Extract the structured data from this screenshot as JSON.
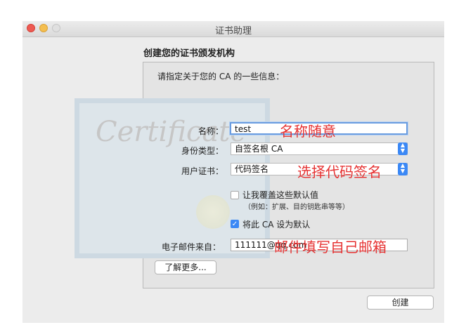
{
  "window": {
    "title": "证书助理"
  },
  "heading": "创建您的证书颁发机构",
  "intro": "请指定关于您的 CA 的一些信息：",
  "background_text": "Certificate",
  "form": {
    "name_label": "名称：",
    "name_value": "test",
    "identity_label": "身份类型：",
    "identity_value": "自签名根 CA",
    "user_cert_label": "用户证书：",
    "user_cert_value": "代码签名",
    "override_label": "让我覆盖这些默认值",
    "override_hint": "（例如：扩展、目的钥匙串等等）",
    "override_checked": false,
    "default_label": "将此 CA 设为默认",
    "default_checked": true,
    "email_label": "电子邮件来自：",
    "email_value": "111111@qq.com"
  },
  "buttons": {
    "learn_more": "了解更多...",
    "create": "创建"
  },
  "annotations": {
    "name_note": "名称随意",
    "cert_note": "选择代码签名",
    "email_note": "邮件填写自己邮箱"
  },
  "colors": {
    "annotation": "#e63232",
    "accent": "#3b88f5"
  }
}
